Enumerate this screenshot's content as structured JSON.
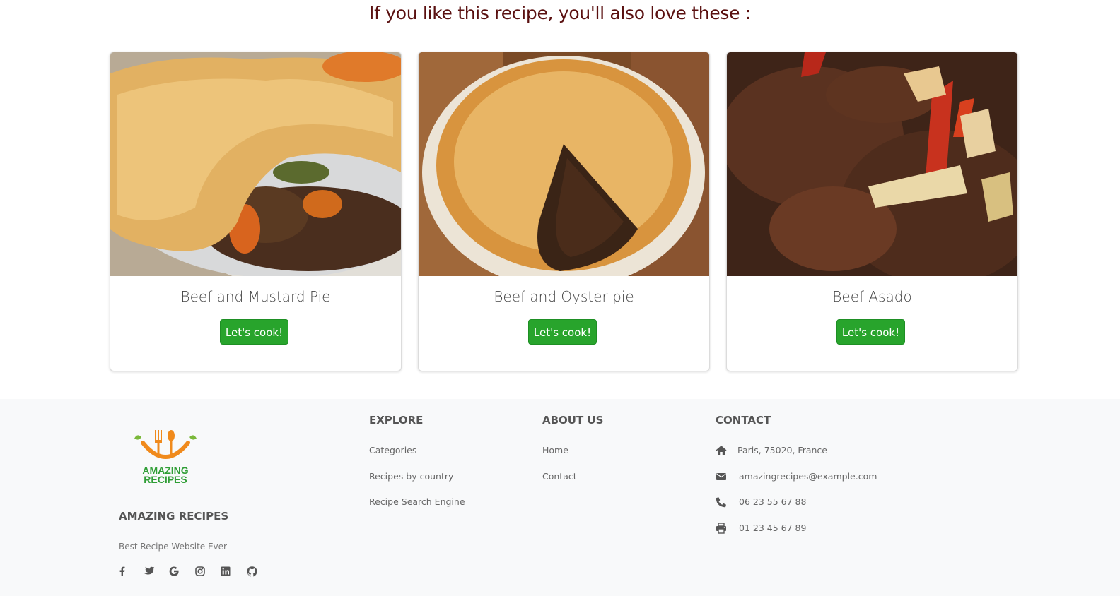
{
  "heading": "If you like this recipe, you'll also love these :",
  "cards": [
    {
      "title": "Beef and Mustard Pie",
      "button": "Let's cook!"
    },
    {
      "title": "Beef and Oyster pie",
      "button": "Let's cook!"
    },
    {
      "title": "Beef Asado",
      "button": "Let's cook!"
    }
  ],
  "footer": {
    "logo_text_1": "AMAZING",
    "logo_text_2": "RECIPES",
    "brand": "AMAZING RECIPES",
    "tagline": "Best Recipe Website Ever",
    "social": [
      "facebook-icon",
      "twitter-icon",
      "google-icon",
      "instagram-icon",
      "linkedin-icon",
      "github-icon"
    ],
    "explore": {
      "title": "EXPLORE",
      "links": [
        "Categories",
        "Recipes by country",
        "Recipe Search Engine"
      ]
    },
    "about": {
      "title": "ABOUT US",
      "links": [
        "Home",
        "Contact"
      ]
    },
    "contact": {
      "title": "CONTACT",
      "address": "Paris, 75020, France",
      "email": "amazingrecipes@example.com",
      "phone": "06 23 55 67 88",
      "fax": "01 23 45 67 89"
    }
  },
  "colors": {
    "heading": "#5a1010",
    "button": "#28a42c",
    "footer_bg": "#f8f9fa",
    "logo_orange": "#f08a1c",
    "logo_green": "#2f9e35"
  }
}
